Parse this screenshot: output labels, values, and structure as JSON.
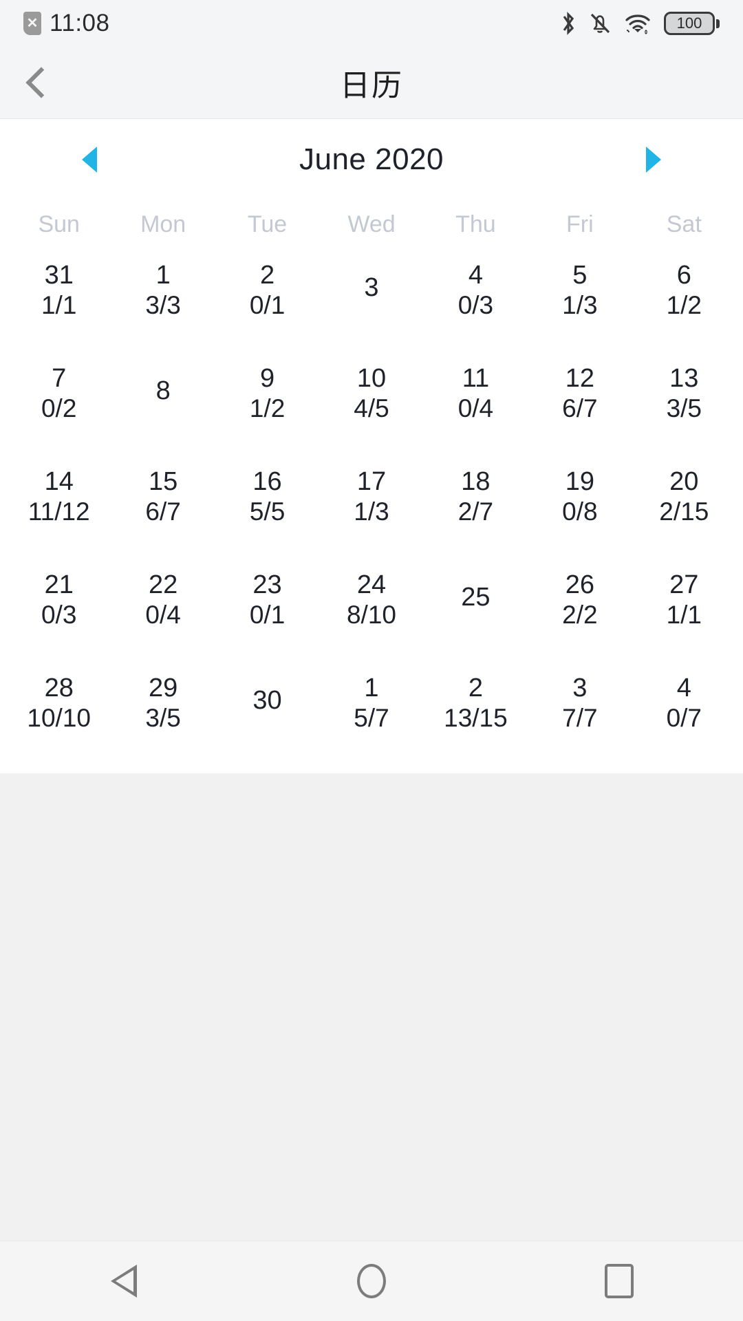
{
  "status_bar": {
    "time": "11:08",
    "sim_icon": "no-sim-icon",
    "sim_glyph": "✕",
    "bluetooth_icon": "bluetooth-icon",
    "silent_icon": "bell-muted-icon",
    "wifi_icon": "wifi-icon",
    "battery_icon": "battery-icon",
    "battery_level": "100"
  },
  "app_bar": {
    "back_icon": "chevron-left-icon",
    "title": "日历"
  },
  "calendar": {
    "month_label": "June 2020",
    "prev_icon": "arrow-left-icon",
    "next_icon": "arrow-right-icon",
    "weekdays": [
      "Sun",
      "Mon",
      "Tue",
      "Wed",
      "Thu",
      "Fri",
      "Sat"
    ],
    "accent_color": "#22b4e6",
    "weeks": [
      [
        {
          "day": "31",
          "sub": "1/1"
        },
        {
          "day": "1",
          "sub": "3/3"
        },
        {
          "day": "2",
          "sub": "0/1"
        },
        {
          "day": "3",
          "sub": ""
        },
        {
          "day": "4",
          "sub": "0/3"
        },
        {
          "day": "5",
          "sub": "1/3"
        },
        {
          "day": "6",
          "sub": "1/2"
        }
      ],
      [
        {
          "day": "7",
          "sub": "0/2"
        },
        {
          "day": "8",
          "sub": ""
        },
        {
          "day": "9",
          "sub": "1/2"
        },
        {
          "day": "10",
          "sub": "4/5"
        },
        {
          "day": "11",
          "sub": "0/4"
        },
        {
          "day": "12",
          "sub": "6/7"
        },
        {
          "day": "13",
          "sub": "3/5"
        }
      ],
      [
        {
          "day": "14",
          "sub": "11/12"
        },
        {
          "day": "15",
          "sub": "6/7"
        },
        {
          "day": "16",
          "sub": "5/5"
        },
        {
          "day": "17",
          "sub": "1/3"
        },
        {
          "day": "18",
          "sub": "2/7"
        },
        {
          "day": "19",
          "sub": "0/8"
        },
        {
          "day": "20",
          "sub": "2/15"
        }
      ],
      [
        {
          "day": "21",
          "sub": "0/3"
        },
        {
          "day": "22",
          "sub": "0/4"
        },
        {
          "day": "23",
          "sub": "0/1"
        },
        {
          "day": "24",
          "sub": "8/10"
        },
        {
          "day": "25",
          "sub": ""
        },
        {
          "day": "26",
          "sub": "2/2"
        },
        {
          "day": "27",
          "sub": "1/1"
        }
      ],
      [
        {
          "day": "28",
          "sub": "10/10"
        },
        {
          "day": "29",
          "sub": "3/5"
        },
        {
          "day": "30",
          "sub": ""
        },
        {
          "day": "1",
          "sub": "5/7"
        },
        {
          "day": "2",
          "sub": "13/15"
        },
        {
          "day": "3",
          "sub": "7/7"
        },
        {
          "day": "4",
          "sub": "0/7"
        }
      ]
    ]
  },
  "nav_bar": {
    "back_icon": "triangle-back-icon",
    "home_icon": "circle-home-icon",
    "recents_icon": "square-recents-icon"
  }
}
